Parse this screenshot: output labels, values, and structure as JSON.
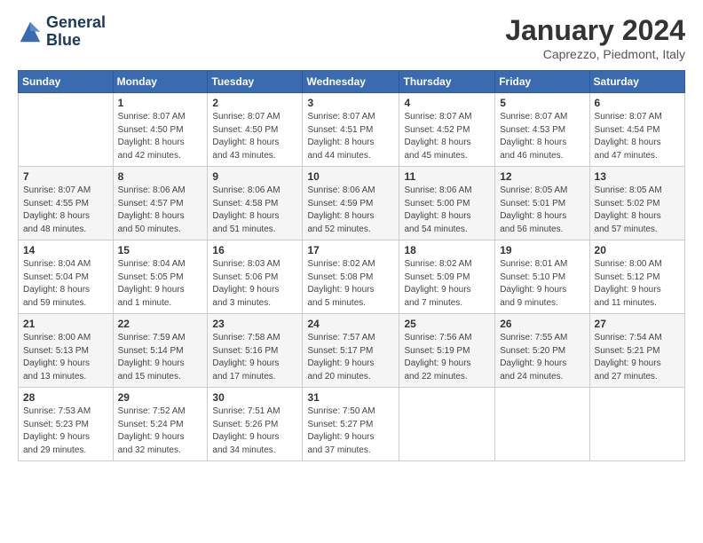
{
  "logo": {
    "line1": "General",
    "line2": "Blue"
  },
  "header": {
    "title": "January 2024",
    "location": "Caprezzo, Piedmont, Italy"
  },
  "days_of_week": [
    "Sunday",
    "Monday",
    "Tuesday",
    "Wednesday",
    "Thursday",
    "Friday",
    "Saturday"
  ],
  "weeks": [
    [
      {
        "day": "",
        "info": ""
      },
      {
        "day": "1",
        "info": "Sunrise: 8:07 AM\nSunset: 4:50 PM\nDaylight: 8 hours\nand 42 minutes."
      },
      {
        "day": "2",
        "info": "Sunrise: 8:07 AM\nSunset: 4:50 PM\nDaylight: 8 hours\nand 43 minutes."
      },
      {
        "day": "3",
        "info": "Sunrise: 8:07 AM\nSunset: 4:51 PM\nDaylight: 8 hours\nand 44 minutes."
      },
      {
        "day": "4",
        "info": "Sunrise: 8:07 AM\nSunset: 4:52 PM\nDaylight: 8 hours\nand 45 minutes."
      },
      {
        "day": "5",
        "info": "Sunrise: 8:07 AM\nSunset: 4:53 PM\nDaylight: 8 hours\nand 46 minutes."
      },
      {
        "day": "6",
        "info": "Sunrise: 8:07 AM\nSunset: 4:54 PM\nDaylight: 8 hours\nand 47 minutes."
      }
    ],
    [
      {
        "day": "7",
        "info": "Sunrise: 8:07 AM\nSunset: 4:55 PM\nDaylight: 8 hours\nand 48 minutes."
      },
      {
        "day": "8",
        "info": "Sunrise: 8:06 AM\nSunset: 4:57 PM\nDaylight: 8 hours\nand 50 minutes."
      },
      {
        "day": "9",
        "info": "Sunrise: 8:06 AM\nSunset: 4:58 PM\nDaylight: 8 hours\nand 51 minutes."
      },
      {
        "day": "10",
        "info": "Sunrise: 8:06 AM\nSunset: 4:59 PM\nDaylight: 8 hours\nand 52 minutes."
      },
      {
        "day": "11",
        "info": "Sunrise: 8:06 AM\nSunset: 5:00 PM\nDaylight: 8 hours\nand 54 minutes."
      },
      {
        "day": "12",
        "info": "Sunrise: 8:05 AM\nSunset: 5:01 PM\nDaylight: 8 hours\nand 56 minutes."
      },
      {
        "day": "13",
        "info": "Sunrise: 8:05 AM\nSunset: 5:02 PM\nDaylight: 8 hours\nand 57 minutes."
      }
    ],
    [
      {
        "day": "14",
        "info": "Sunrise: 8:04 AM\nSunset: 5:04 PM\nDaylight: 8 hours\nand 59 minutes."
      },
      {
        "day": "15",
        "info": "Sunrise: 8:04 AM\nSunset: 5:05 PM\nDaylight: 9 hours\nand 1 minute."
      },
      {
        "day": "16",
        "info": "Sunrise: 8:03 AM\nSunset: 5:06 PM\nDaylight: 9 hours\nand 3 minutes."
      },
      {
        "day": "17",
        "info": "Sunrise: 8:02 AM\nSunset: 5:08 PM\nDaylight: 9 hours\nand 5 minutes."
      },
      {
        "day": "18",
        "info": "Sunrise: 8:02 AM\nSunset: 5:09 PM\nDaylight: 9 hours\nand 7 minutes."
      },
      {
        "day": "19",
        "info": "Sunrise: 8:01 AM\nSunset: 5:10 PM\nDaylight: 9 hours\nand 9 minutes."
      },
      {
        "day": "20",
        "info": "Sunrise: 8:00 AM\nSunset: 5:12 PM\nDaylight: 9 hours\nand 11 minutes."
      }
    ],
    [
      {
        "day": "21",
        "info": "Sunrise: 8:00 AM\nSunset: 5:13 PM\nDaylight: 9 hours\nand 13 minutes."
      },
      {
        "day": "22",
        "info": "Sunrise: 7:59 AM\nSunset: 5:14 PM\nDaylight: 9 hours\nand 15 minutes."
      },
      {
        "day": "23",
        "info": "Sunrise: 7:58 AM\nSunset: 5:16 PM\nDaylight: 9 hours\nand 17 minutes."
      },
      {
        "day": "24",
        "info": "Sunrise: 7:57 AM\nSunset: 5:17 PM\nDaylight: 9 hours\nand 20 minutes."
      },
      {
        "day": "25",
        "info": "Sunrise: 7:56 AM\nSunset: 5:19 PM\nDaylight: 9 hours\nand 22 minutes."
      },
      {
        "day": "26",
        "info": "Sunrise: 7:55 AM\nSunset: 5:20 PM\nDaylight: 9 hours\nand 24 minutes."
      },
      {
        "day": "27",
        "info": "Sunrise: 7:54 AM\nSunset: 5:21 PM\nDaylight: 9 hours\nand 27 minutes."
      }
    ],
    [
      {
        "day": "28",
        "info": "Sunrise: 7:53 AM\nSunset: 5:23 PM\nDaylight: 9 hours\nand 29 minutes."
      },
      {
        "day": "29",
        "info": "Sunrise: 7:52 AM\nSunset: 5:24 PM\nDaylight: 9 hours\nand 32 minutes."
      },
      {
        "day": "30",
        "info": "Sunrise: 7:51 AM\nSunset: 5:26 PM\nDaylight: 9 hours\nand 34 minutes."
      },
      {
        "day": "31",
        "info": "Sunrise: 7:50 AM\nSunset: 5:27 PM\nDaylight: 9 hours\nand 37 minutes."
      },
      {
        "day": "",
        "info": ""
      },
      {
        "day": "",
        "info": ""
      },
      {
        "day": "",
        "info": ""
      }
    ]
  ]
}
